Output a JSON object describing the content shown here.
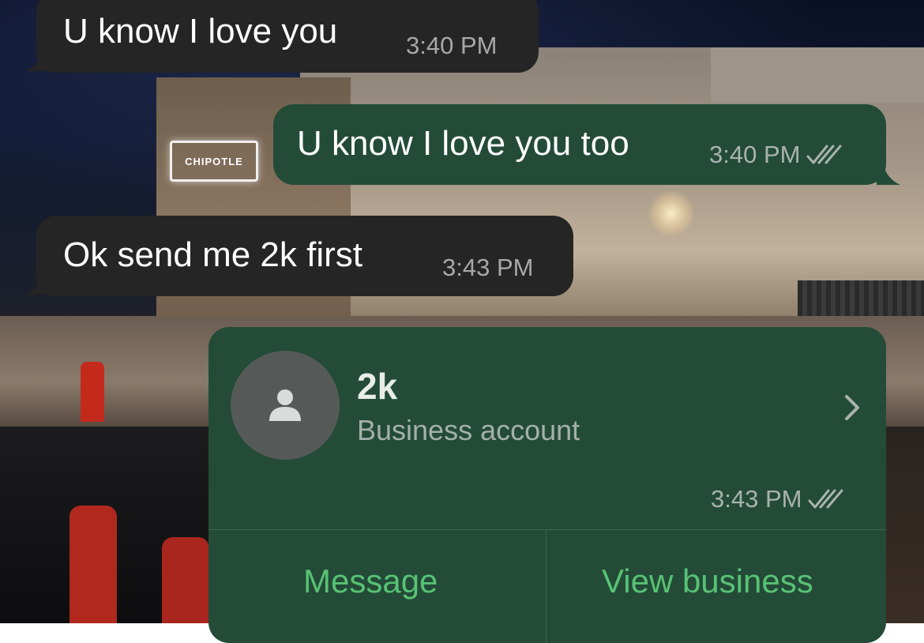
{
  "messages": [
    {
      "direction": "incoming",
      "text": "U know I love you",
      "time": "3:40 PM"
    },
    {
      "direction": "outgoing",
      "text": "U know I love you too",
      "time": "3:40 PM",
      "status_icon": "double-check-icon"
    },
    {
      "direction": "incoming",
      "text": "Ok send me 2k first",
      "time": "3:43 PM"
    }
  ],
  "contact_card": {
    "name": "2k",
    "subtitle": "Business account",
    "time": "3:43 PM",
    "status_icon": "double-check-icon",
    "avatar_icon": "person-icon",
    "chevron_icon": "chevron-right-icon",
    "actions": {
      "message_label": "Message",
      "view_business_label": "View business"
    }
  },
  "wallpaper": {
    "sign_text": "CHIPOTLE"
  },
  "colors": {
    "incoming_bubble": "#252525",
    "outgoing_bubble": "#234b38",
    "action_green": "#58c274",
    "meta_text": "#a9b3ae"
  }
}
